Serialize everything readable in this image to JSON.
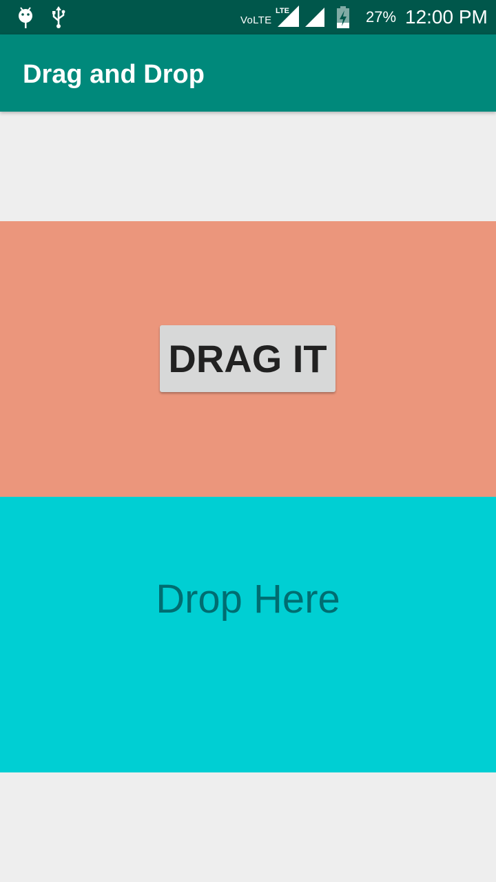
{
  "status_bar": {
    "left_icons": [
      "android-debug-icon",
      "usb-icon"
    ],
    "network_label": "VoLTE",
    "lte_label": "LTE",
    "battery_percent": "27%",
    "time": "12:00 PM"
  },
  "app_bar": {
    "title": "Drag and Drop"
  },
  "drag_zone": {
    "color": "#eb967c",
    "button_label": "DRAG IT"
  },
  "drop_zone": {
    "color": "#00cfd3",
    "label": "Drop Here"
  },
  "colors": {
    "status_bar": "#00574b",
    "app_bar": "#00897b",
    "background": "#eeeeee"
  }
}
